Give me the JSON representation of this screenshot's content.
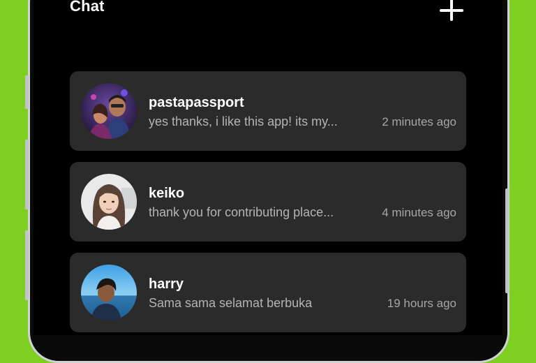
{
  "header": {
    "title": "Chat",
    "new_chat_icon": "plus-icon"
  },
  "chats": [
    {
      "name": "pastapassport",
      "preview": "yes thanks, i like this app! its my...",
      "time": "2 minutes ago",
      "avatar": "avatar-photo-couple"
    },
    {
      "name": "keiko",
      "preview": "thank you for contributing place...",
      "time": "4 minutes ago",
      "avatar": "avatar-photo-woman"
    },
    {
      "name": "harry",
      "preview": "Sama sama selamat berbuka",
      "time": "19 hours ago",
      "avatar": "avatar-photo-man-beach"
    }
  ],
  "colors": {
    "background": "#7fcf22",
    "screen": "#000000",
    "card": "#2b2b2b",
    "text_primary": "#ffffff",
    "text_secondary": "#b4b4b4"
  }
}
